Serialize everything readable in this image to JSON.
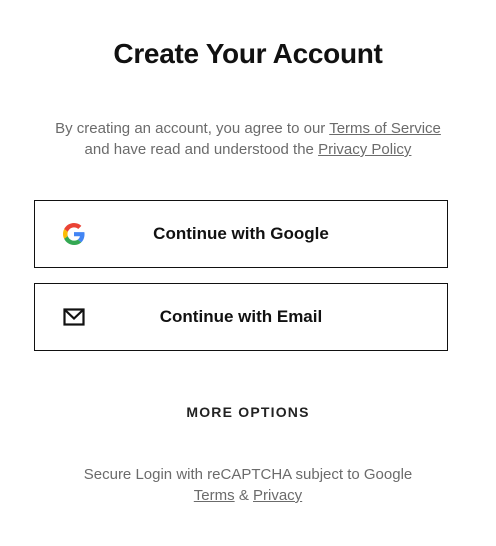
{
  "header": {
    "title": "Create Your Account"
  },
  "agreement": {
    "prefix": "By creating an account, you agree to our",
    "terms_link": "Terms of Service",
    "middle": "and have read and understood the",
    "privacy_link": "Privacy Policy"
  },
  "auth_buttons": {
    "google": {
      "label": "Continue with Google",
      "icon": "google-icon"
    },
    "email": {
      "label": "Continue with Email",
      "icon": "envelope-icon"
    }
  },
  "more_options": {
    "label": "MORE OPTIONS"
  },
  "recaptcha": {
    "text": "Secure Login with reCAPTCHA subject to Google",
    "terms_link": "Terms",
    "separator": "&",
    "privacy_link": "Privacy"
  },
  "colors": {
    "text": "#111111",
    "muted": "#6b6b6b",
    "border": "#111111",
    "google_blue": "#4285F4",
    "google_red": "#EA4335",
    "google_yellow": "#FBBC05",
    "google_green": "#34A853"
  }
}
